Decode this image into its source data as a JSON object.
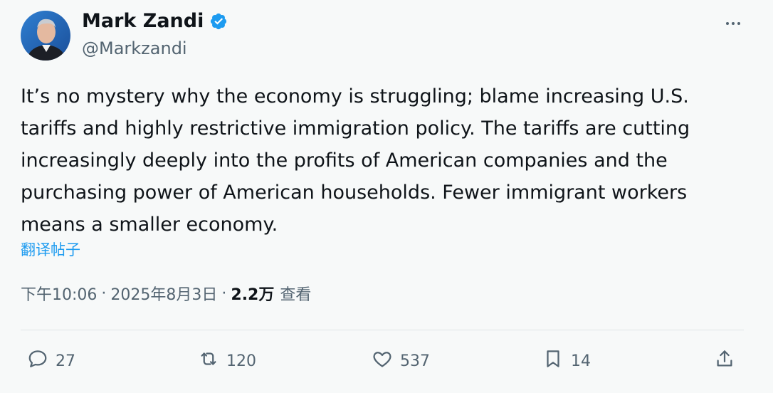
{
  "author": {
    "name": "Mark Zandi",
    "handle": "@Markzandi",
    "verified": true
  },
  "tweet": {
    "text": "It’s no mystery why the economy is struggling; blame increasing U.S.\ntariffs and highly restrictive immigration policy. The tariffs are cutting\nincreasingly deeply into the profits of American companies and the\npurchasing power of American households. Fewer immigrant workers\nmeans a smaller economy.",
    "translate_label": "翻译帖子"
  },
  "meta": {
    "time": "下午10:06",
    "date": "2025年8月3日",
    "views_count": "2.2万",
    "views_label": "查看",
    "separator": "·"
  },
  "actions": {
    "reply": {
      "icon": "reply-icon",
      "count": "27"
    },
    "retweet": {
      "icon": "retweet-icon",
      "count": "120"
    },
    "like": {
      "icon": "heart-icon",
      "count": "537"
    },
    "bookmark": {
      "icon": "bookmark-icon",
      "count": "14"
    },
    "share": {
      "icon": "share-icon"
    }
  },
  "colors": {
    "accent": "#1d9bf0",
    "secondary_text": "#536471",
    "primary_text": "#0f1419",
    "background": "#f7f9f9"
  }
}
